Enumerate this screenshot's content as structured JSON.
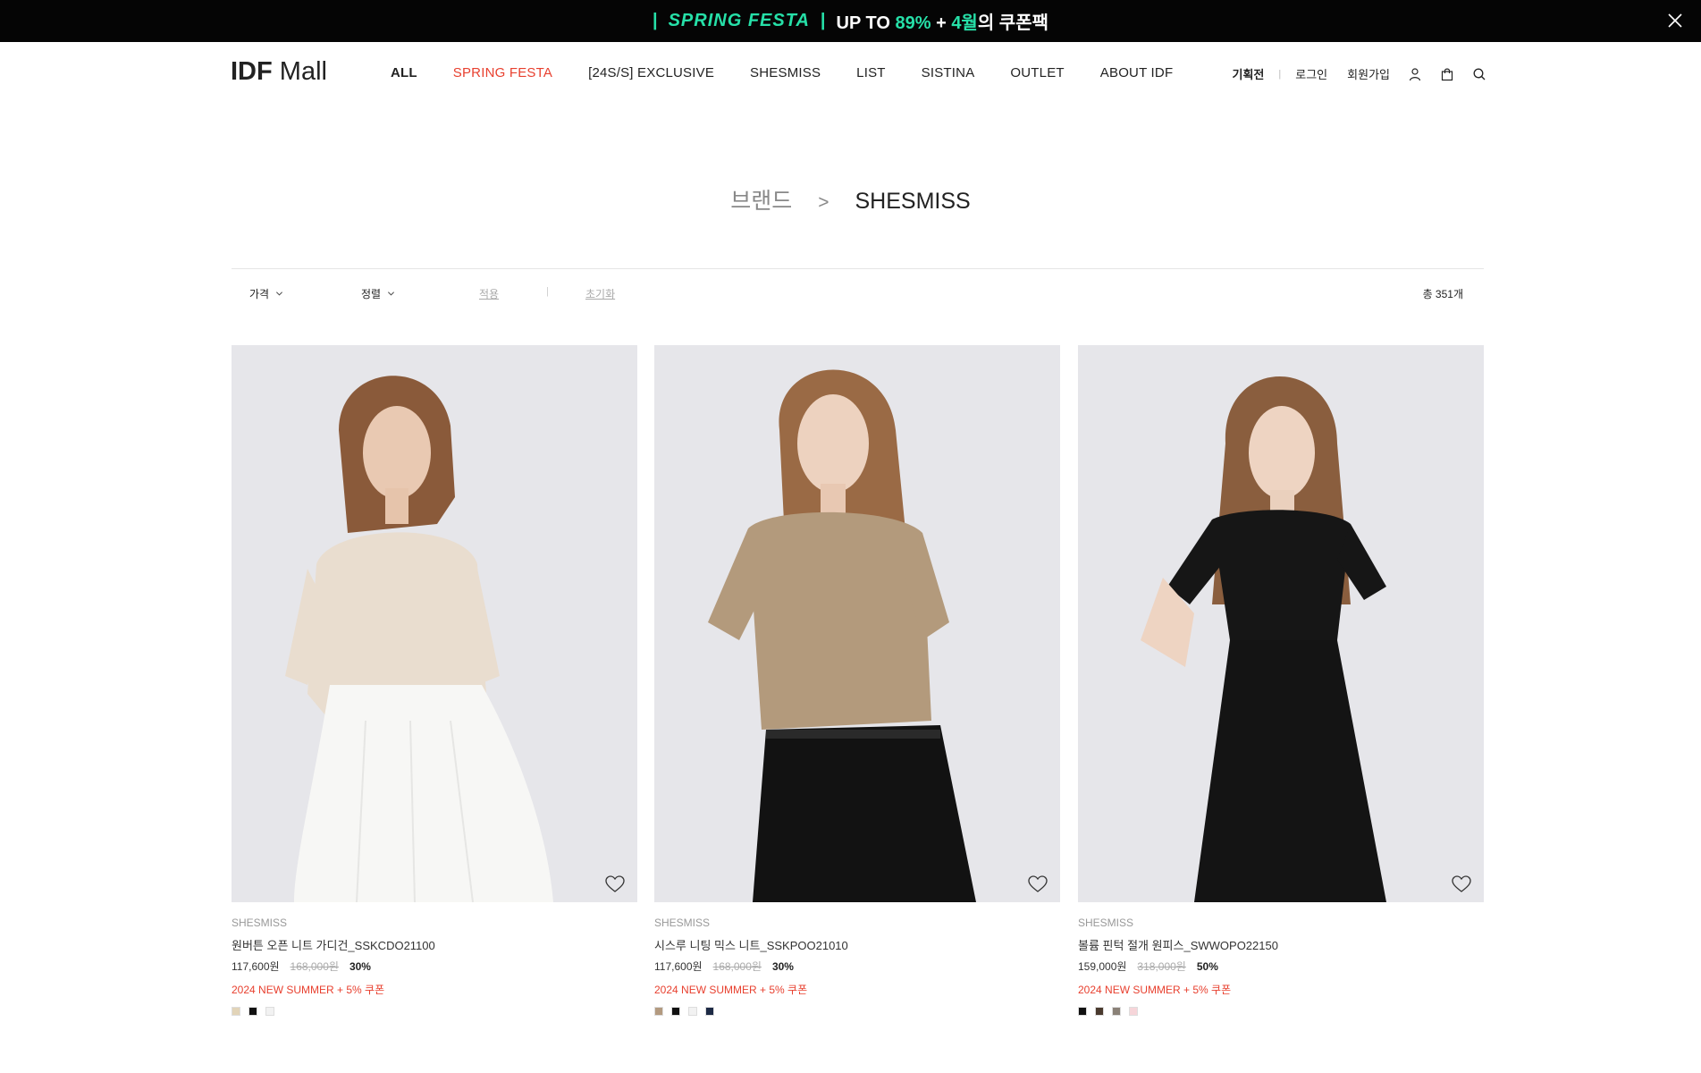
{
  "banner": {
    "bar_left": "|",
    "festa": "SPRING FESTA",
    "bar_right": "|",
    "up_to": "UP TO",
    "percent": "89%",
    "plus": "+",
    "month": "4월",
    "suffix": "의 쿠폰팩"
  },
  "header": {
    "logo_bold": "IDF",
    "logo_thin": "Mall",
    "nav": [
      {
        "label": "ALL"
      },
      {
        "label": "SPRING FESTA"
      },
      {
        "label": "[24S/S] EXCLUSIVE"
      },
      {
        "label": "SHESMISS"
      },
      {
        "label": "LIST"
      },
      {
        "label": "SISTINA"
      },
      {
        "label": "OUTLET"
      },
      {
        "label": "ABOUT IDF"
      }
    ],
    "util": {
      "planned": "기획전",
      "sep": "|",
      "login": "로그인",
      "signup": "회원가입"
    }
  },
  "title": {
    "parent": "브랜드",
    "sep": ">",
    "current": "SHESMISS"
  },
  "filters": {
    "price": "가격",
    "sort": "정렬",
    "apply": "적용",
    "sep": "|",
    "reset": "초기화",
    "total": "총 351개"
  },
  "colors": {
    "accent_green": "#26e0a8",
    "promo_red": "#e8402f"
  },
  "products": [
    {
      "brand": "SHESMISS",
      "name": "원버튼 오픈 니트 가디건_SSKCDO21100",
      "price": "117,600원",
      "original_price": "168,000원",
      "discount": "30%",
      "coupon": "2024 NEW SUMMER + 5% 쿠폰",
      "swatches": [
        "#e2d4b8",
        "#111111",
        "#f2f2f2"
      ]
    },
    {
      "brand": "SHESMISS",
      "name": "시스루 니팅 믹스 니트_SSKPOO21010",
      "price": "117,600원",
      "original_price": "168,000원",
      "discount": "30%",
      "coupon": "2024 NEW SUMMER + 5% 쿠폰",
      "swatches": [
        "#b39a80",
        "#111111",
        "#f2f2f2",
        "#1d2a45"
      ]
    },
    {
      "brand": "SHESMISS",
      "name": "볼륨 핀턱 절개 원피스_SWWOPO22150",
      "price": "159,000원",
      "original_price": "318,000원",
      "discount": "50%",
      "coupon": "2024 NEW SUMMER + 5% 쿠폰",
      "swatches": [
        "#111111",
        "#4a3a2e",
        "#8a8177",
        "#f6d5d9"
      ]
    }
  ]
}
